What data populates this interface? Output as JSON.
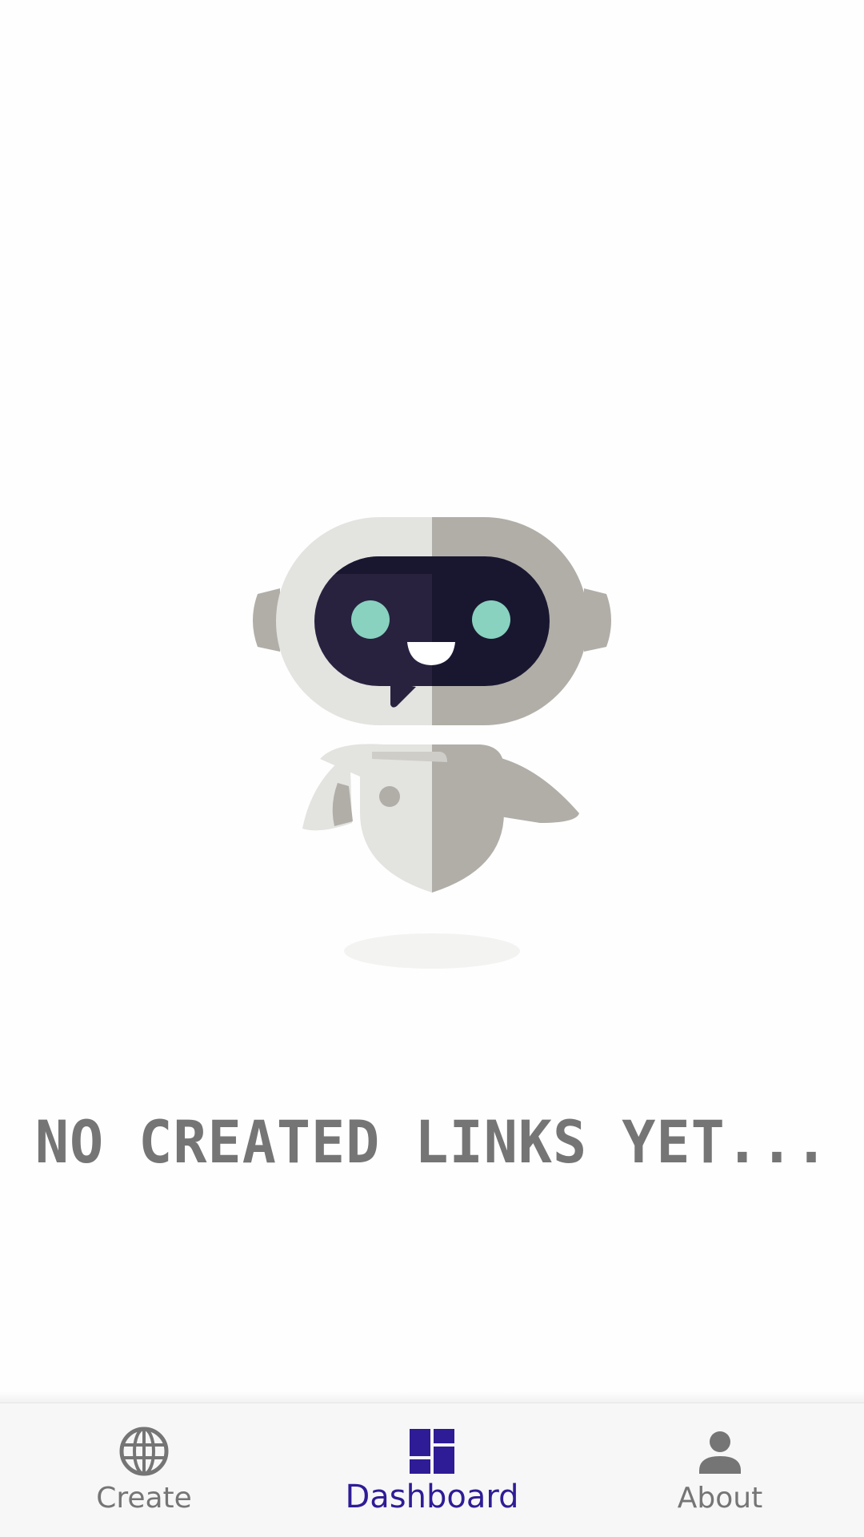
{
  "empty_state": {
    "message": "NO CREATED LINKS YET..."
  },
  "bottom_nav": {
    "items": [
      {
        "label": "Create",
        "icon": "globe-icon",
        "active": false
      },
      {
        "label": "Dashboard",
        "icon": "dashboard-icon",
        "active": true
      },
      {
        "label": "About",
        "icon": "person-icon",
        "active": false
      }
    ]
  },
  "colors": {
    "active": "#2e1c96",
    "inactive": "#757575",
    "nav_background": "#f7f7f7",
    "robot_light": "#e3e3e0",
    "robot_dark": "#b1aea8",
    "robot_visor": "#191730",
    "robot_eyes": "#88d2bf"
  }
}
